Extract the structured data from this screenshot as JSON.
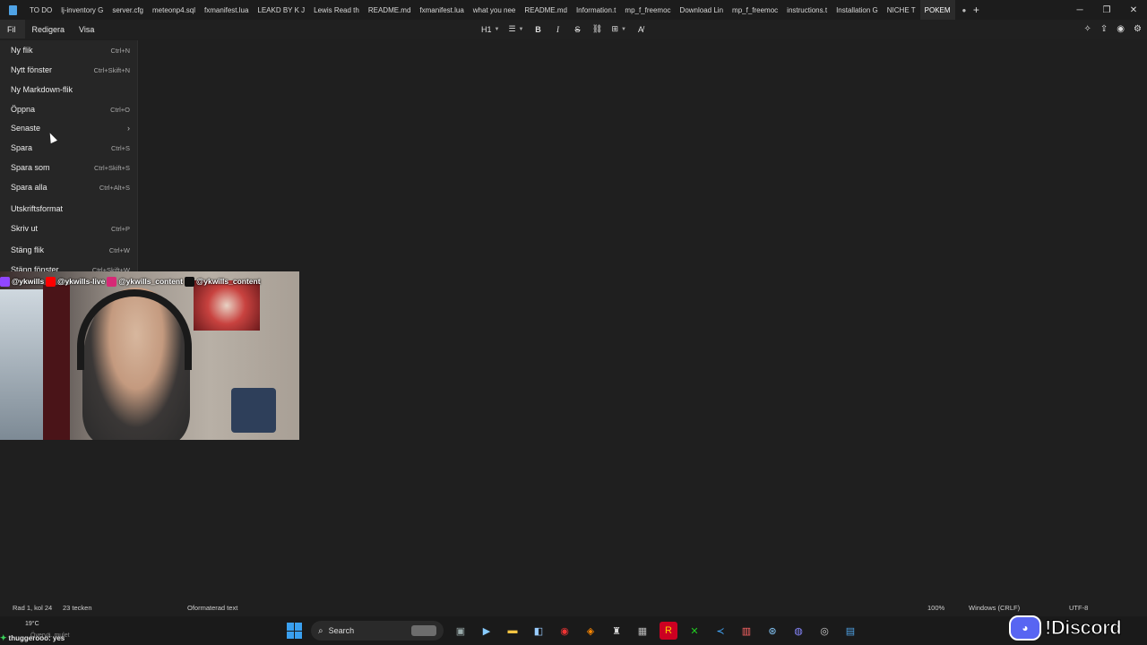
{
  "tabs": [
    {
      "label": "TO DO",
      "active": false
    },
    {
      "label": "lj-inventory G",
      "active": false
    },
    {
      "label": "server.cfg",
      "active": false
    },
    {
      "label": "meteonp4.sql",
      "active": false
    },
    {
      "label": "fxmanifest.lua",
      "active": false
    },
    {
      "label": "LEAKD BY K J",
      "active": false
    },
    {
      "label": "Lewis Read th",
      "active": false
    },
    {
      "label": "README.md",
      "active": false
    },
    {
      "label": "fxmanifest.lua",
      "active": false
    },
    {
      "label": "what you nee",
      "active": false
    },
    {
      "label": "README.md",
      "active": false
    },
    {
      "label": "Information.t",
      "active": false
    },
    {
      "label": "mp_f_freemoc",
      "active": false
    },
    {
      "label": "Download Lin",
      "active": false
    },
    {
      "label": "mp_f_freemoc",
      "active": false
    },
    {
      "label": "instructions.t",
      "active": false
    },
    {
      "label": "Installation G",
      "active": false
    },
    {
      "label": "NICHE T",
      "active": false
    },
    {
      "label": "POKEM",
      "active": true
    }
  ],
  "menubar": {
    "file": "Fil",
    "edit": "Redigera",
    "view": "Visa"
  },
  "toolbar": {
    "heading": "H1",
    "bold": "B",
    "italic": "I",
    "strike": "S"
  },
  "file_menu": [
    {
      "label": "Ny flik",
      "shortcut": "Ctrl+N"
    },
    {
      "label": "Nytt fönster",
      "shortcut": "Ctrl+Skift+N"
    },
    {
      "label": "Ny Markdown-flik",
      "shortcut": ""
    },
    {
      "label": "Öppna",
      "shortcut": "Ctrl+O"
    },
    {
      "label": "Senaste",
      "shortcut": "",
      "submenu": true
    },
    {
      "label": "Spara",
      "shortcut": "Ctrl+S"
    },
    {
      "label": "Spara som",
      "shortcut": "Ctrl+Skift+S"
    },
    {
      "label": "Spara alla",
      "shortcut": "Ctrl+Alt+S"
    },
    {
      "label": "Utskriftsformat",
      "shortcut": ""
    },
    {
      "label": "Skriv ut",
      "shortcut": "Ctrl+P"
    },
    {
      "label": "Stäng flik",
      "shortcut": "Ctrl+W"
    },
    {
      "label": "Stäng fönster",
      "shortcut": "Ctrl+Skift+W"
    }
  ],
  "overlay_socials": [
    {
      "handle": "@ykwills",
      "icon": "twitch-icon",
      "color": "#9146ff"
    },
    {
      "handle": "@ykwills-live",
      "icon": "youtube-icon",
      "color": "#ff0000"
    },
    {
      "handle": "@ykwills_content",
      "icon": "instagram-icon",
      "color": "#d62976"
    },
    {
      "handle": "@ykwills_content",
      "icon": "tiktok-icon",
      "color": "#111111"
    }
  ],
  "status": {
    "position": "Rad 1, kol 24",
    "chars": "23 tecken",
    "format": "Oformaterad text",
    "zoom": "100%",
    "line_ending": "Windows (CRLF)",
    "encoding": "UTF-8"
  },
  "taskbar": {
    "temperature": "19°C",
    "weather_sub": "Övervä. mulet",
    "chat_line": "thuggerooo: yes",
    "search_placeholder": "Search"
  },
  "discord_overlay": {
    "text": "!Discord"
  },
  "colors": {
    "accent": "#4fa3e6",
    "background": "#1f1f1f",
    "menu": "#262626"
  }
}
